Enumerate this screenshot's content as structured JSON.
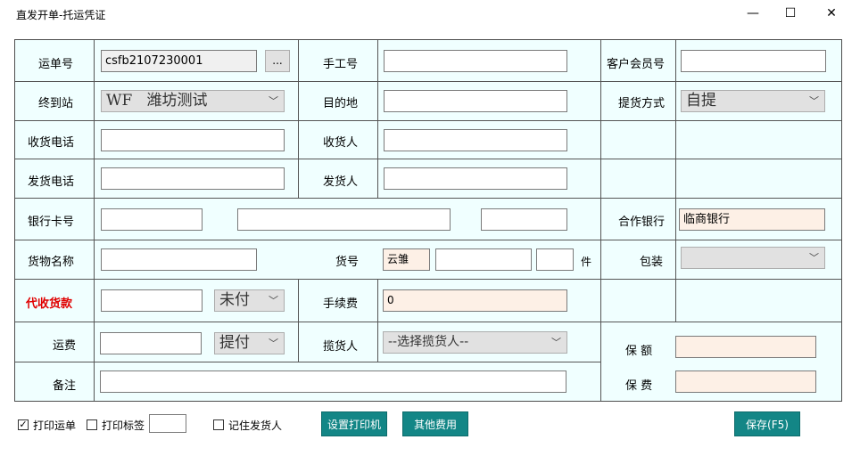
{
  "window": {
    "title": "直发开单-托运凭证",
    "minimize": "—",
    "maximize": "☐",
    "close": "✕"
  },
  "row1": {
    "waybill_label": "运单号",
    "waybill_value": "csfb2107230001",
    "dots": "...",
    "manual_label": "手工号",
    "manual_value": "",
    "member_label": "客户会员号",
    "member_value": ""
  },
  "row2": {
    "dest_station_label": "终到站",
    "dest_station_value": "WF   潍坊测试",
    "destination_label": "目的地",
    "destination_value": "",
    "pickup_label": "提货方式",
    "pickup_value": "自提"
  },
  "row3": {
    "receiver_phone_label": "收货电话",
    "receiver_phone_value": "",
    "receiver_label": "收货人",
    "receiver_value": ""
  },
  "row4": {
    "sender_phone_label": "发货电话",
    "sender_phone_value": "",
    "sender_label": "发货人",
    "sender_value": ""
  },
  "row5": {
    "bank_card_label": "银行卡号",
    "bank_card_value1": "",
    "bank_card_value2": "",
    "bank_card_value3": "",
    "partner_bank_label": "合作银行",
    "partner_bank_value": "临商银行"
  },
  "row6": {
    "goods_name_label": "货物名称",
    "goods_name_value": "",
    "goods_no_label": "货号",
    "goods_no_prefix": "云雏",
    "goods_no_value": "",
    "goods_qty_value": "",
    "piece_unit": "件",
    "package_label": "包装",
    "package_value": ""
  },
  "row7": {
    "cod_label": "代收货款",
    "cod_value": "",
    "cod_status": "未付",
    "fee_label": "手续费",
    "fee_value": "0"
  },
  "row8": {
    "freight_label": "运费",
    "freight_value": "",
    "freight_method": "提付",
    "collector_label": "揽货人",
    "collector_value": "--选择揽货人--",
    "insured_amount_label": "保 额",
    "insured_amount_value": ""
  },
  "row9": {
    "remark_label": "备注",
    "remark_value": "",
    "insurance_fee_label": "保 费",
    "insurance_fee_value": ""
  },
  "bottom": {
    "print_waybill_label": "打印运单",
    "print_waybill_checked": "✓",
    "print_label_label": "打印标签",
    "print_label_count": "",
    "remember_sender_label": "记住发货人",
    "set_printer": "设置打印机",
    "other_fees": "其他费用",
    "save": "保存(F5)"
  },
  "colors": {
    "form_bg": "#f0ffff",
    "teal_button": "#138686",
    "peach_field": "#fdf0e6",
    "red_label": "#e00000"
  }
}
